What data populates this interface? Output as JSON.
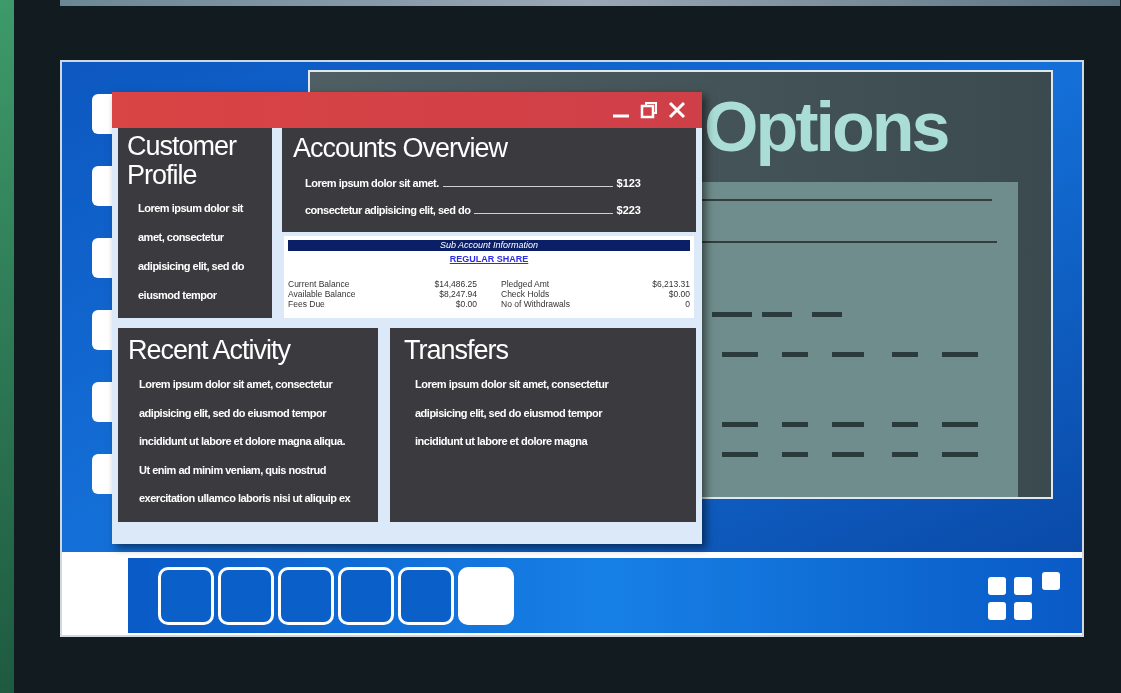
{
  "slide": {
    "title": "Options"
  },
  "main_window": {
    "customer_profile": {
      "title": "Customer Profile",
      "lines": [
        "Lorem ipsum dolor sit",
        "amet, consectetur",
        "adipisicing elit, sed do",
        "eiusmod tempor"
      ]
    },
    "accounts_overview": {
      "title": "Accounts Overview",
      "rows": [
        {
          "label": "Lorem ipsum dolor sit amet.",
          "amount": "$123"
        },
        {
          "label": "consectetur adipisicing elit, sed do",
          "amount": "$223"
        }
      ]
    },
    "sub_account": {
      "header": "Sub Account Information",
      "link": "REGULAR SHARE",
      "columns": [
        [
          {
            "label": "Current Balance",
            "value": "$14,486.25"
          },
          {
            "label": "Available Balance",
            "value": "$8,247.94"
          },
          {
            "label": "Fees Due",
            "value": "$0.00"
          }
        ],
        [
          {
            "label": "Pledged Amt",
            "value": "$6,213.31"
          },
          {
            "label": "Check Holds",
            "value": "$0.00"
          },
          {
            "label": "No of Withdrawals",
            "value": "0"
          }
        ]
      ]
    },
    "recent_activity": {
      "title": "Recent Activity",
      "lines": [
        "Lorem ipsum dolor sit amet, consectetur",
        "adipisicing elit, sed do eiusmod tempor",
        "incididunt ut labore et dolore magna aliqua.",
        "Ut enim ad minim veniam, quis nostrud",
        "exercitation ullamco laboris nisi ut aliquip ex"
      ]
    },
    "transfers": {
      "title": "Transfers",
      "lines": [
        "Lorem ipsum dolor sit amet, consectetur",
        "adipisicing elit, sed do eiusmod tempor",
        "incididunt ut labore et dolore magna"
      ]
    }
  },
  "pager": [
    {
      "selected": false
    },
    {
      "selected": false
    },
    {
      "selected": false
    },
    {
      "selected": false
    },
    {
      "selected": false
    },
    {
      "selected": true
    }
  ]
}
